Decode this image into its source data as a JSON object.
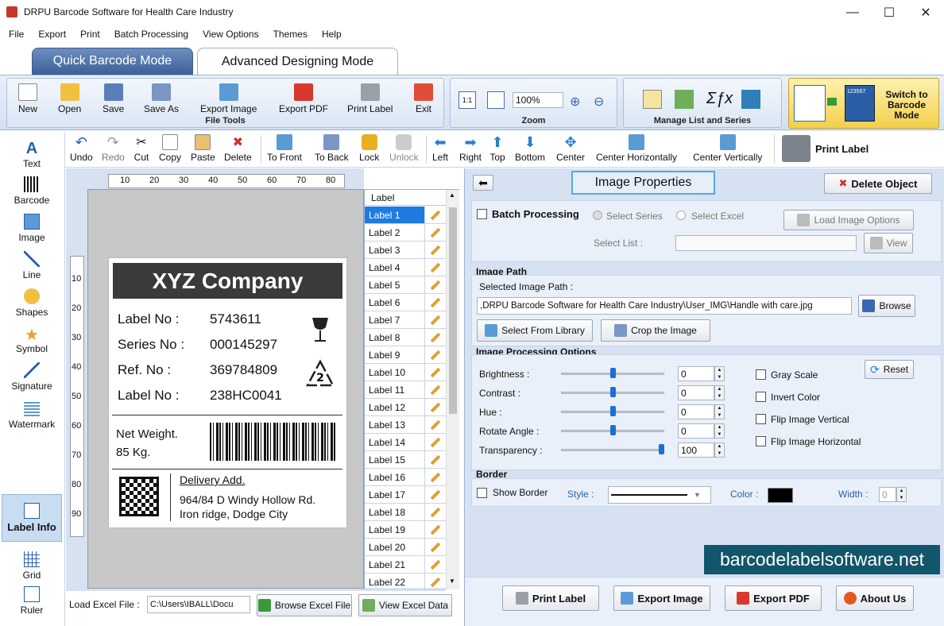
{
  "window": {
    "title": "DRPU Barcode Software for Health Care Industry",
    "min": "—",
    "max": "☐",
    "close": "✕"
  },
  "menu": [
    "File",
    "Export",
    "Print",
    "Batch Processing",
    "View Options",
    "Themes",
    "Help"
  ],
  "modes": {
    "quick": "Quick Barcode Mode",
    "advanced": "Advanced Designing Mode"
  },
  "ribbon": {
    "file_tools": {
      "label": "File Tools",
      "buttons": [
        "New",
        "Open",
        "Save",
        "Save As",
        "Export Image",
        "Export PDF",
        "Print Label",
        "Exit"
      ]
    },
    "zoom": {
      "label": "Zoom",
      "value": "100%"
    },
    "manage": {
      "label": "Manage List and Series"
    },
    "switch": {
      "label": "Switch to Barcode Mode",
      "line1": "Switch to",
      "line2": "Barcode",
      "line3": "Mode",
      "preview_num": "123567"
    }
  },
  "toolbar": {
    "buttons": [
      "Undo",
      "Redo",
      "Cut",
      "Copy",
      "Paste",
      "Delete",
      "To Front",
      "To Back",
      "Lock",
      "Unlock",
      "Left",
      "Right",
      "Top",
      "Bottom",
      "Center",
      "Center Horizontally",
      "Center Vertically"
    ],
    "print_label": "Print Label"
  },
  "tools": [
    "Text",
    "Barcode",
    "Image",
    "Line",
    "Shapes",
    "Symbol",
    "Signature",
    "Watermark",
    "Label Info",
    "Grid",
    "Ruler"
  ],
  "ruler": {
    "top": [
      "10",
      "20",
      "30",
      "40",
      "50",
      "60",
      "70",
      "80"
    ],
    "left": [
      "10",
      "20",
      "30",
      "40",
      "50",
      "60",
      "70",
      "80",
      "90"
    ]
  },
  "label": {
    "company": "XYZ Company",
    "fields": [
      {
        "key": "Label No :",
        "value": "5743611"
      },
      {
        "key": "Series No :",
        "value": "000145297"
      },
      {
        "key": "Ref. No :",
        "value": "369784809"
      },
      {
        "key": "Label No :",
        "value": "238HC0041"
      }
    ],
    "weight_line1": "Net Weight.",
    "weight_line2": "85 Kg.",
    "recycle_number": "2",
    "delivery_title": "Delivery Add.",
    "address_line1": "964/84 D Windy Hollow Rd.",
    "address_line2": "Iron ridge, Dodge City"
  },
  "label_list": {
    "header": "Label",
    "items": [
      "Label 1",
      "Label 2",
      "Label 3",
      "Label 4",
      "Label 5",
      "Label 6",
      "Label 7",
      "Label 8",
      "Label 9",
      "Label 10",
      "Label 11",
      "Label 12",
      "Label 13",
      "Label 14",
      "Label 15",
      "Label 16",
      "Label 17",
      "Label 18",
      "Label 19",
      "Label 20",
      "Label 21",
      "Label 22"
    ],
    "selected": 0
  },
  "excel": {
    "label": "Load Excel File :",
    "path": "C:\\Users\\IBALL\\Docu",
    "browse": "Browse Excel File",
    "view": "View Excel Data"
  },
  "props": {
    "title": "Image Properties",
    "delete": "Delete Object",
    "batch": {
      "label": "Batch Processing",
      "select_series": "Select Series",
      "select_excel": "Select Excel",
      "load_options": "Load Image Options",
      "select_list": "Select List :",
      "view": "View"
    },
    "image_path": {
      "title": "Image Path",
      "selected_label": "Selected Image Path :",
      "value": ",DRPU Barcode Software for Health Care Industry\\User_IMG\\Handle with care.jpg",
      "browse": "Browse",
      "library": "Select From Library",
      "crop": "Crop the Image"
    },
    "processing": {
      "title": "Image Processing Options",
      "rows": [
        {
          "label": "Brightness :",
          "value": "0",
          "pos": 0.5
        },
        {
          "label": "Contrast :",
          "value": "0",
          "pos": 0.5
        },
        {
          "label": "Hue :",
          "value": "0",
          "pos": 0.5
        },
        {
          "label": "Rotate Angle :",
          "value": "0",
          "pos": 0.5
        },
        {
          "label": "Transparency :",
          "value": "100",
          "pos": 1.0
        }
      ],
      "reset": "Reset",
      "checks": [
        "Gray Scale",
        "Invert Color",
        "Flip Image Vertical",
        "Flip Image Horizontal"
      ]
    },
    "border": {
      "title": "Border",
      "show": "Show Border",
      "style_label": "Style :",
      "color_label": "Color :",
      "color": "#000000",
      "width_label": "Width :",
      "width": "0"
    }
  },
  "footer": {
    "print": "Print Label",
    "export_image": "Export Image",
    "export_pdf": "Export PDF",
    "about": "About Us"
  },
  "brand": "barcodelabelsoftware.net"
}
